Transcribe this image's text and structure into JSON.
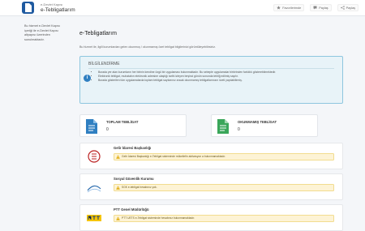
{
  "header": {
    "brand_subtitle": "e-Devlet Kapısı",
    "brand_title": "e-Tebligatlarım",
    "nav": [
      {
        "label": "Favorilerimde",
        "icon": "star-icon"
      },
      {
        "label": "Paylaş",
        "icon": "comment-icon"
      },
      {
        "label": "Paylaş",
        "icon": "share-icon"
      }
    ]
  },
  "sidebar": {
    "text": "Bu hizmet e-Devlet Kapısı içeriği ile e-Devlet Kapısı altyapısı üzerinden sunulmaktadır."
  },
  "main": {
    "title": "e-Tebligatlarım",
    "description": "Bu hizmet ile, ilgili kurumlardan gelen okunmuş / okunmamış özet tebligat bilgilerinizi görüntüleyebilirsiniz.",
    "info": {
      "title": "BİLGİLENDİRME",
      "items": [
        "Burada yer alan kurumların her birinin kendine özgü bir uygulaması bulunmaktadır. Bu sebeple uygulamalar birbirinden farklılık gösterebilmektedir.",
        "Elektronik tebligat, muhatabın elektronik adresine ulaştığı tarihi izleyen beşinci günün sonunda tebliğ edilmiş sayılır.",
        "Burada gösterilen tüm uygulamalarda toplam tebligat sayılarınız ancak okunmamış tebligatlarınızın özeti yapılabilirmiş."
      ]
    },
    "cards": [
      {
        "title": "TOPLAM TEBLİGAT",
        "value": "0",
        "color": "#2f7fc1"
      },
      {
        "title": "OKUNMAMIŞ TEBLİGAT",
        "value": "0",
        "color": "#3aa65a"
      }
    ],
    "institutions": [
      {
        "name": "Gelir İdaresi Başkanlığı",
        "message": "Gelir İdaresi Başkanlığı e-Tebligat sisteminde mükellefin aktivasyon a bulunmamaktadır.",
        "logo": "gib-logo"
      },
      {
        "name": "Sosyal Güvenlik Kurumu",
        "message": "SGK e-tebligat hesabınız yok.",
        "logo": "sgk-logo"
      },
      {
        "name": "PTT Genel Müdürlüğü",
        "message": "PTT UETS e-Tebligat sisteminde hesabınız bulunmamaktadır.",
        "logo": "ptt-logo"
      }
    ],
    "colors": {
      "info_border": "#8ec6df",
      "warning_bg": "#fdf3d5",
      "warning_icon": "#e0a800"
    }
  }
}
